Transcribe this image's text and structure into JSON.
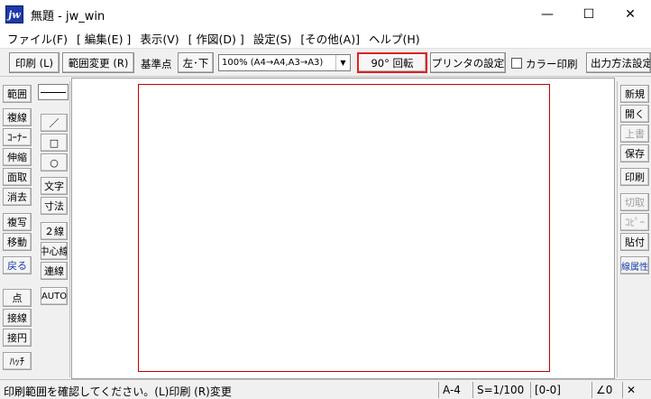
{
  "window": {
    "app_icon": "jw",
    "title": "無題 - jw_win",
    "minimize": "—",
    "maximize": "☐",
    "close": "✕"
  },
  "menu": [
    "ファイル(F)",
    "[ 編集(E) ]",
    "表示(V)",
    "[ 作図(D) ]",
    "設定(S)",
    "[その他(A)]",
    "ヘルプ(H)"
  ],
  "toolbar": {
    "print": "印刷 (L)",
    "range_change": "範囲変更 (R)",
    "base_point_label": "基準点",
    "base_point_value": "左･下",
    "scale_select": "100% (A4→A4,A3→A3)",
    "rotate": "90° 回転",
    "printer_settings": "プリンタの設定",
    "color_print": "カラー印刷",
    "output_method": "出力方法設定"
  },
  "left_tools": [
    "範囲",
    "複線",
    "ｺｰﾅｰ",
    "伸縮",
    "面取",
    "消去",
    "複写",
    "移動",
    "戻る",
    "点",
    "接線",
    "接円",
    "ﾊｯﾁ"
  ],
  "left_tools2": [
    "／",
    "□",
    "○",
    "文字",
    "寸法",
    "２線",
    "中心線",
    "連線",
    "AUTO"
  ],
  "right_tools": [
    "新規",
    "開く",
    "上書",
    "保存",
    "印刷",
    "切取",
    "ｺﾋﾟｰ",
    "貼付",
    "線属性"
  ],
  "status": {
    "message": "印刷範囲を確認してください。(L)印刷 (R)変更",
    "paper": "A-4",
    "scale": "S=1/100",
    "layer": "[0-0]",
    "angle": "∠0",
    "close": "✕"
  },
  "colors": {
    "print_frame": "#c00000",
    "highlight": "#e02020",
    "blue_text": "#1a3fb0"
  }
}
